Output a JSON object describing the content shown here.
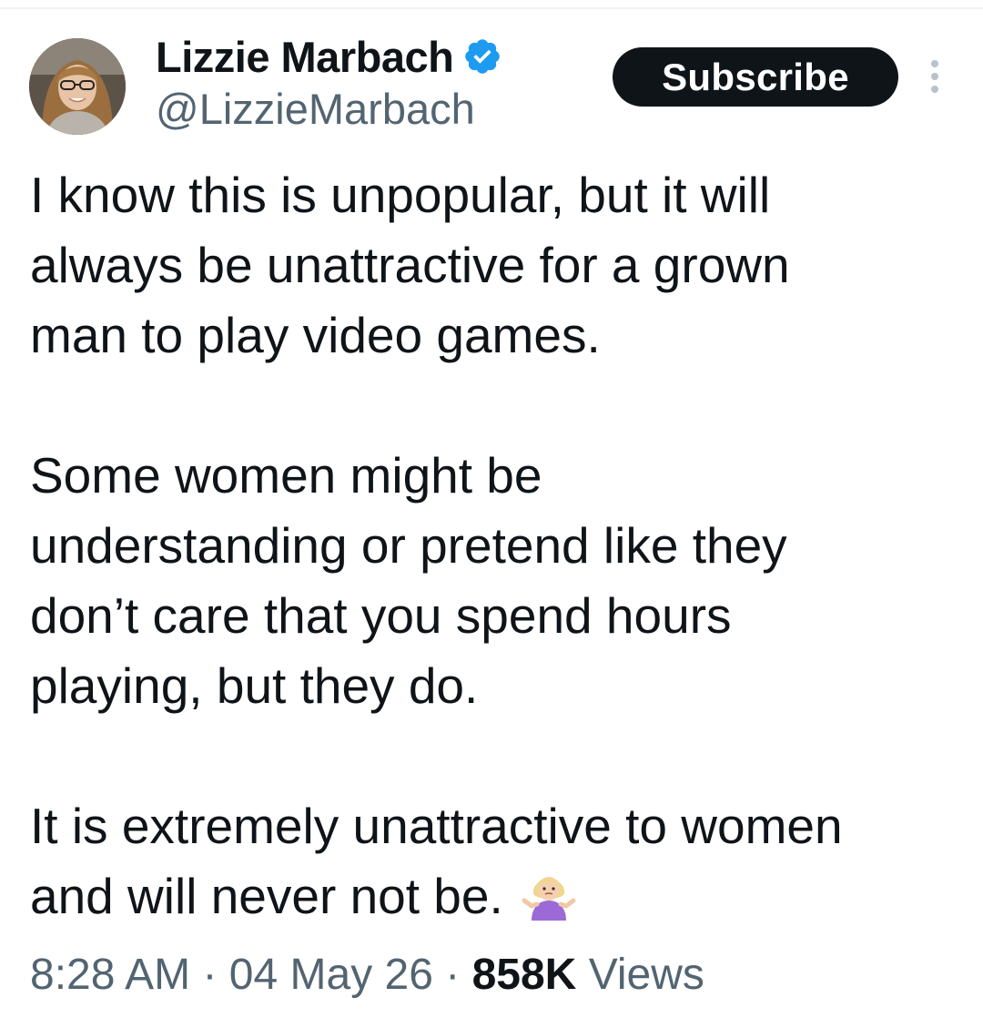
{
  "author": {
    "display_name": "Lizzie Marbach",
    "handle": "@LizzieMarbach",
    "verified": true,
    "verified_color": "#1d9bf0"
  },
  "actions": {
    "subscribe_label": "Subscribe",
    "more_icon": "more-vertical-icon"
  },
  "tweet": {
    "paragraphs": [
      {
        "lines": [
          "I know this is unpopular, but it will",
          "always be unattractive for a grown",
          "man to play video games."
        ]
      },
      {
        "lines": [
          "Some women might be",
          "understanding or pretend like they",
          "don’t care that you spend hours",
          "playing, but they do."
        ]
      },
      {
        "lines": [
          "It is extremely unattractive to women",
          "and will never not be."
        ],
        "emoji": "woman-shrugging-emoji"
      }
    ]
  },
  "meta": {
    "time": "8:28 AM",
    "separator": "·",
    "date": "04 May 26",
    "views_count": "858K",
    "views_label": "Views"
  },
  "colors": {
    "text_primary": "#0f1419",
    "text_secondary": "#536471",
    "button_bg": "#0f1419"
  }
}
